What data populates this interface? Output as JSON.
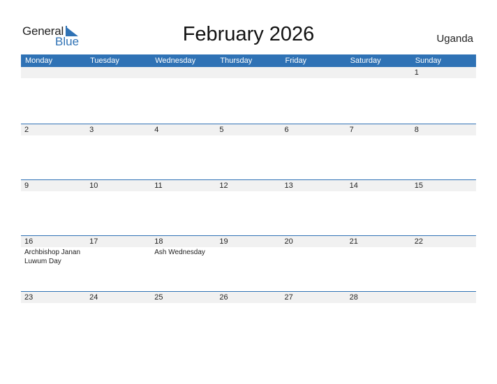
{
  "logo": {
    "general": "General",
    "blue": "Blue"
  },
  "title": "February 2026",
  "country": "Uganda",
  "colors": {
    "accent": "#2f72b5",
    "date_strip": "#f1f1f1"
  },
  "weekdays": [
    "Monday",
    "Tuesday",
    "Wednesday",
    "Thursday",
    "Friday",
    "Saturday",
    "Sunday"
  ],
  "weeks": [
    {
      "days": [
        "",
        "",
        "",
        "",
        "",
        "",
        "1"
      ],
      "events": [
        "",
        "",
        "",
        "",
        "",
        "",
        ""
      ]
    },
    {
      "days": [
        "2",
        "3",
        "4",
        "5",
        "6",
        "7",
        "8"
      ],
      "events": [
        "",
        "",
        "",
        "",
        "",
        "",
        ""
      ]
    },
    {
      "days": [
        "9",
        "10",
        "11",
        "12",
        "13",
        "14",
        "15"
      ],
      "events": [
        "",
        "",
        "",
        "",
        "",
        "",
        ""
      ]
    },
    {
      "days": [
        "16",
        "17",
        "18",
        "19",
        "20",
        "21",
        "22"
      ],
      "events": [
        "Archbishop Janan Luwum Day",
        "",
        "Ash Wednesday",
        "",
        "",
        "",
        ""
      ]
    },
    {
      "days": [
        "23",
        "24",
        "25",
        "26",
        "27",
        "28",
        ""
      ],
      "events": [
        "",
        "",
        "",
        "",
        "",
        "",
        ""
      ]
    }
  ]
}
